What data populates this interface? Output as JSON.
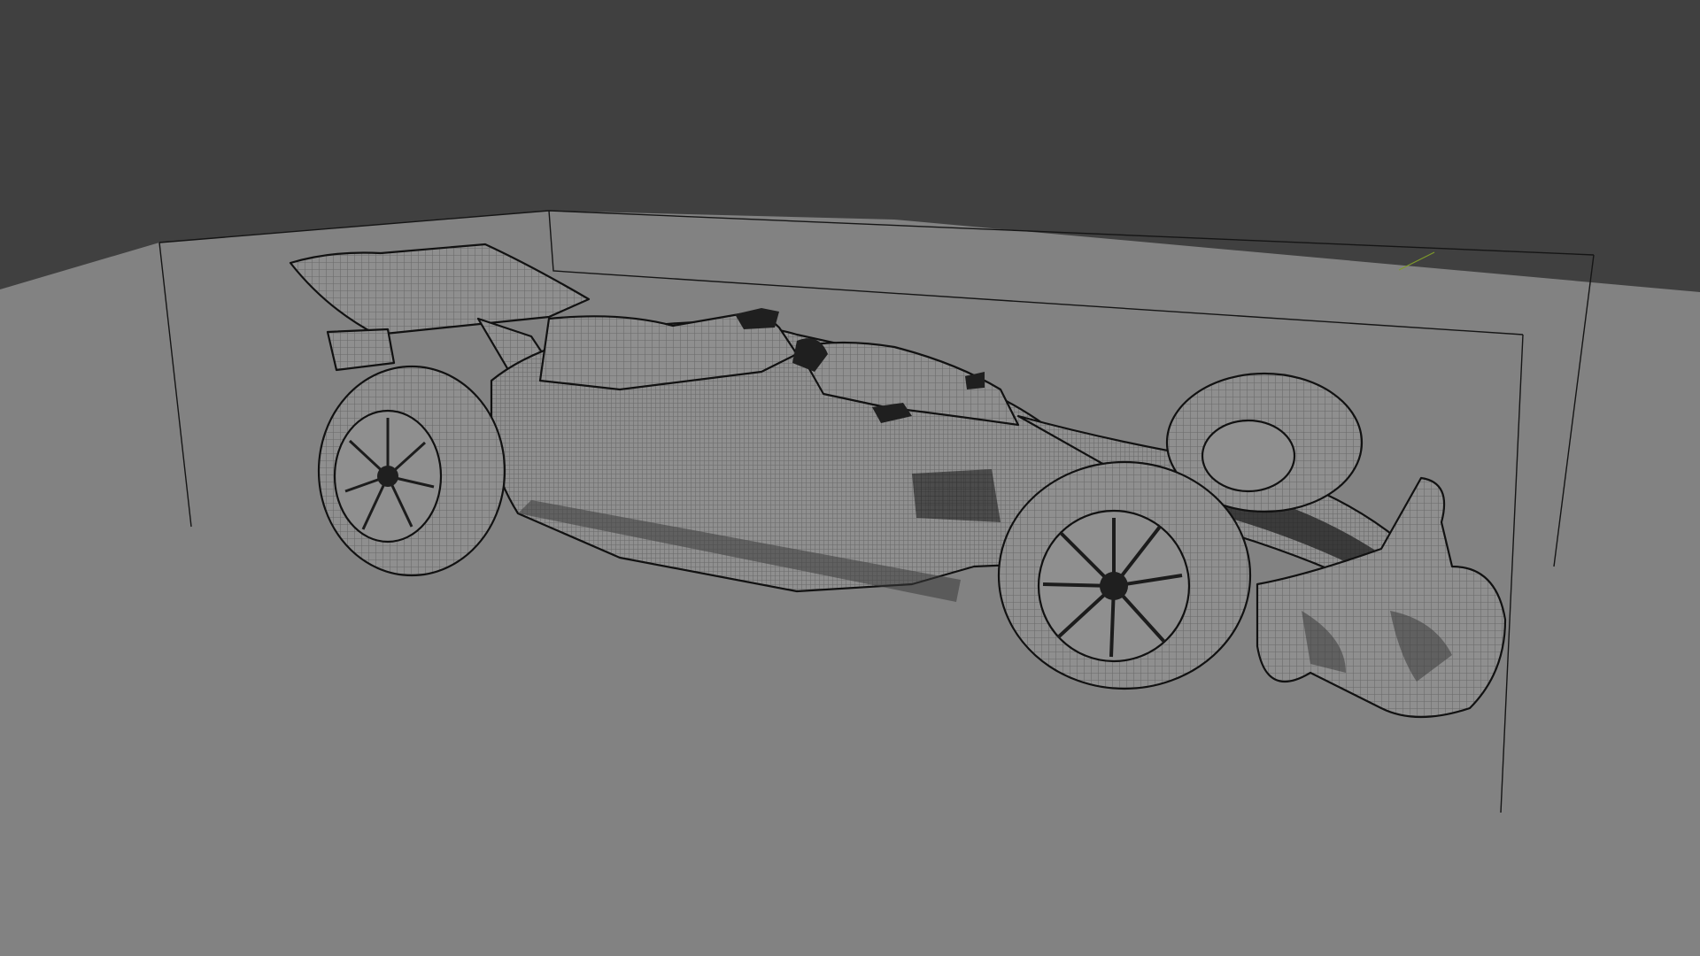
{
  "viewport": {
    "background_color": "#404040",
    "floor_color": "#828282",
    "wire_color": "#1c1c1c",
    "mesh_color": "#8f8f8f"
  },
  "scene": {
    "object": "formula-race-car-wireframe",
    "display_mode": "wireframe-overlay",
    "bounding_box_visible": true
  }
}
